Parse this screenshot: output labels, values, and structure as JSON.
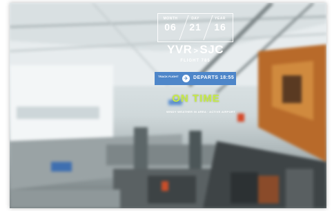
{
  "flight_card": {
    "date": [
      {
        "label": "MONTH",
        "value": "06"
      },
      {
        "label": "DAY",
        "value": "21"
      },
      {
        "label": "YEAR",
        "value": "16"
      }
    ],
    "origin": "YVR",
    "destination": "SJC",
    "flight_label": "FLIGHT 785",
    "track_label": "TRACK FLIGHT",
    "departs_text": "DEPARTS 18:55",
    "status": "ON TIME",
    "ticker": "WINDY WEATHER IN AREA · ACTIVE AIRPORT"
  },
  "colors": {
    "accent_blue": "#4e86c9",
    "status_green": "#c6e94a",
    "text_white": "#ffffff"
  }
}
